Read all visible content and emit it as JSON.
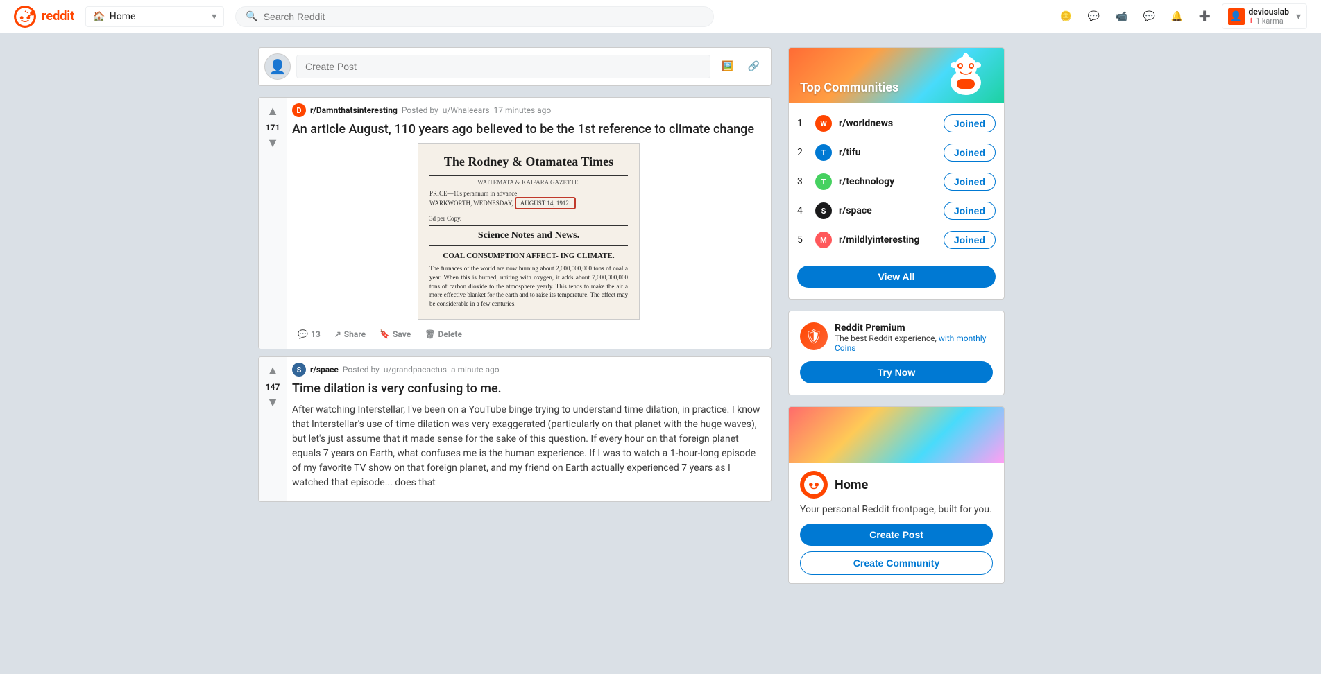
{
  "header": {
    "logo_text": "reddit",
    "home_label": "Home",
    "search_placeholder": "Search Reddit",
    "user": {
      "name": "deviouslab",
      "karma": "1 karma"
    }
  },
  "create_post_bar": {
    "placeholder": "Create Post"
  },
  "posts": [
    {
      "id": "post-1",
      "subreddit": "r/Damnthatsinteresting",
      "posted_by": "Posted by",
      "author": "u/Whaleears",
      "time": "17 minutes ago",
      "vote_count": "171",
      "title": "An article August, 110 years ago believed to be the 1st reference to climate change",
      "has_image": true,
      "actions": [
        {
          "label": "13",
          "icon": "comment"
        },
        {
          "label": "Share",
          "icon": "share"
        },
        {
          "label": "Save",
          "icon": "bookmark"
        },
        {
          "label": "Delete",
          "icon": "trash"
        }
      ]
    },
    {
      "id": "post-2",
      "subreddit": "r/space",
      "posted_by": "Posted by",
      "author": "u/grandpacactus",
      "time": "a minute ago",
      "vote_count": "147",
      "title": "Time dilation is very confusing to me.",
      "body": "After watching Interstellar, I've been on a YouTube binge trying to understand time dilation, in practice. I know that Interstellar's use of time dilation was very exaggerated (particularly on that planet with the huge waves), but let's just assume that it made sense for the sake of this question. If every hour on that foreign planet equals 7 years on Earth, what confuses me is the human experience. If I was to watch a 1-hour-long episode of my favorite TV show on that foreign planet, and my friend on Earth actually experienced 7 years as I watched that episode... does that",
      "has_image": false,
      "actions": []
    }
  ],
  "sidebar": {
    "top_communities": {
      "title": "Top Communities",
      "communities": [
        {
          "rank": "1",
          "name": "r/worldnews",
          "joined": true,
          "join_label": "Joined"
        },
        {
          "rank": "2",
          "name": "r/tifu",
          "joined": true,
          "join_label": "Joined"
        },
        {
          "rank": "3",
          "name": "r/technology",
          "joined": true,
          "join_label": "Joined"
        },
        {
          "rank": "4",
          "name": "r/space",
          "joined": true,
          "join_label": "Joined"
        },
        {
          "rank": "5",
          "name": "r/mildlyinteresting",
          "joined": true,
          "join_label": "Joined"
        }
      ],
      "view_all_label": "View All"
    },
    "premium": {
      "title": "Reddit Premium",
      "description": "The best Reddit experience, with monthly Coins",
      "try_now_label": "Try Now"
    },
    "home": {
      "title": "Home",
      "description": "Your personal Reddit frontpage, built for you.",
      "create_post_label": "Create Post",
      "create_community_label": "Create Community"
    }
  },
  "newspaper": {
    "title": "The Rodney & Otamatea Times",
    "subtitle": "WAITEMATA & KAIPARA GAZETTE.",
    "price": "PRICE—10s perannum in advance",
    "location": "WARKWORTH, WEDNESDAY,",
    "date": "AUGUST 14, 1912.",
    "copy": "3d per Copy.",
    "section": "Science Notes and News.",
    "article_title": "COAL CONSUMPTION AFFECT-\nING CLIMATE.",
    "body": "The furnaces of the world are now burning about 2,000,000,000 tons of coal a year. When this is burned, uniting with oxygen, it adds about 7,000,000,000 tons of carbon dioxide to the atmosphere yearly. This tends to make the air a more effective blanket for the earth and to raise its temperature. The effect may be considerable in a few centuries."
  }
}
